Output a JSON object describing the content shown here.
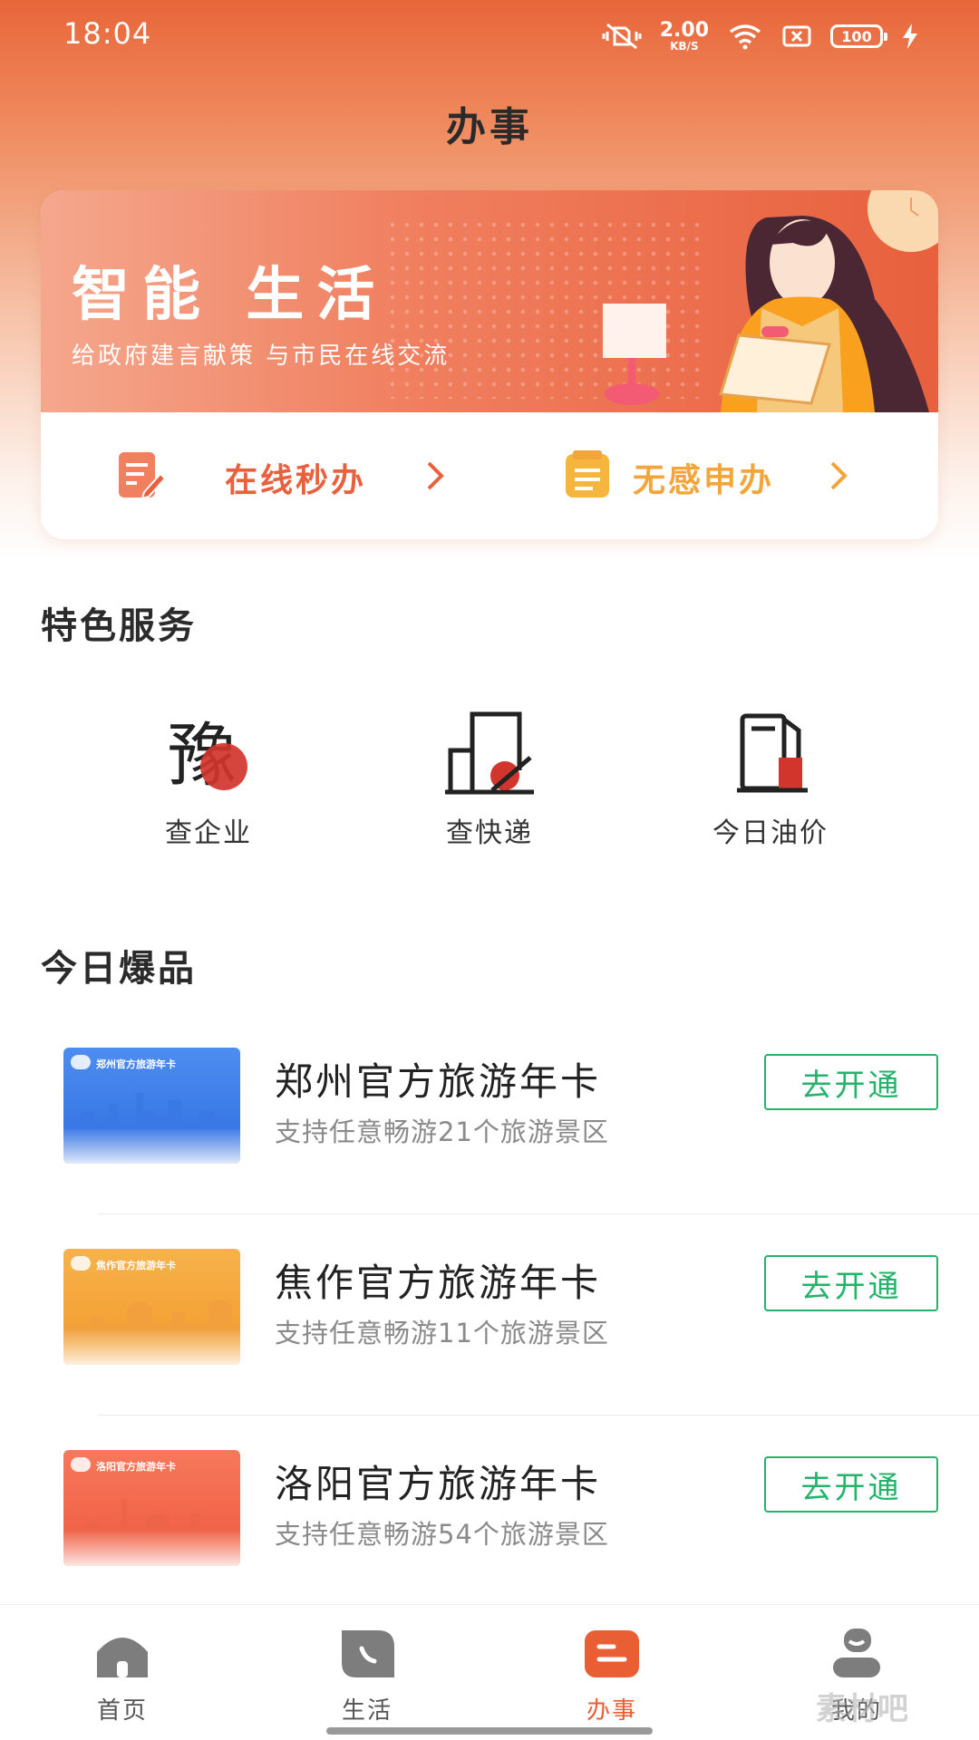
{
  "status_bar": {
    "time": "18:04",
    "net_speed_value": "2.00",
    "net_speed_unit": "KB/S",
    "battery": "100",
    "icons": [
      "mute-vibrate-icon",
      "wifi-icon",
      "no-sim-icon",
      "battery-icon",
      "charging-icon"
    ]
  },
  "header": {
    "title": "办事"
  },
  "banner": {
    "title": "智能 生活",
    "subtitle": "给政府建言献策 与市民在线交流",
    "colors": {
      "start": "#f5a78d",
      "end": "#e8603d"
    }
  },
  "quick_actions": [
    {
      "label": "在线秒办",
      "icon": "edit-document-icon",
      "color": "#e8603d"
    },
    {
      "label": "无感申办",
      "icon": "note-icon",
      "color": "#f3a53a"
    }
  ],
  "featured": {
    "title": "特色服务",
    "items": [
      {
        "label": "查企业",
        "icon": "enterprise-seal-icon"
      },
      {
        "label": "查快递",
        "icon": "package-icon"
      },
      {
        "label": "今日油价",
        "icon": "fuel-pump-icon"
      }
    ]
  },
  "hot": {
    "title": "今日爆品",
    "items": [
      {
        "name": "郑州官方旅游年卡",
        "desc": "支持任意畅游21个旅游景区",
        "button": "去开通",
        "thumb_title": "郑州官方旅游年卡",
        "thumb_color": "#3d7de8"
      },
      {
        "name": "焦作官方旅游年卡",
        "desc": "支持任意畅游11个旅游景区",
        "button": "去开通",
        "thumb_title": "焦作官方旅游年卡",
        "thumb_color": "#f4a13a"
      },
      {
        "name": "洛阳官方旅游年卡",
        "desc": "支持任意畅游54个旅游景区",
        "button": "去开通",
        "thumb_title": "洛阳官方旅游年卡",
        "thumb_color": "#f0664a"
      }
    ]
  },
  "tab_bar": {
    "tabs": [
      {
        "label": "首页",
        "icon": "home-icon"
      },
      {
        "label": "生活",
        "icon": "life-icon"
      },
      {
        "label": "办事",
        "icon": "service-icon",
        "active": true
      },
      {
        "label": "我的",
        "icon": "profile-icon"
      }
    ],
    "active_color": "#ea5e34"
  },
  "watermark": "素材吧"
}
